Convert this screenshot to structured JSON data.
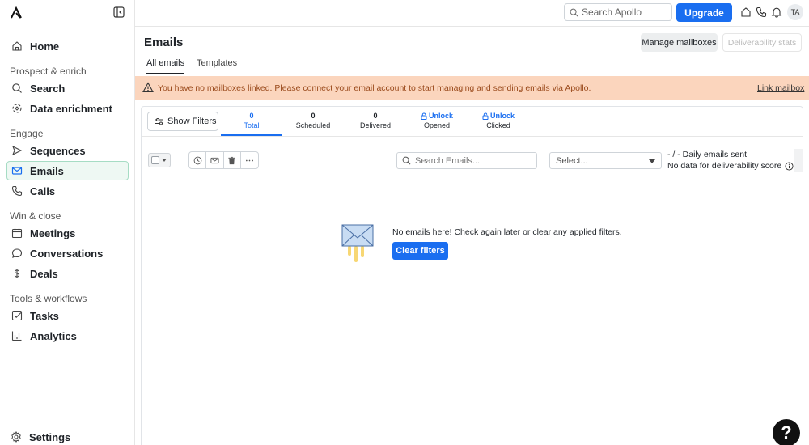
{
  "sidebar": {
    "items": {
      "home": "Home",
      "search": "Search",
      "data_enrichment": "Data enrichment",
      "sequences": "Sequences",
      "emails": "Emails",
      "calls": "Calls",
      "meetings": "Meetings",
      "conversations": "Conversations",
      "deals": "Deals",
      "tasks": "Tasks",
      "analytics": "Analytics",
      "settings": "Settings"
    },
    "sections": {
      "prospect": "Prospect & enrich",
      "engage": "Engage",
      "win": "Win & close",
      "tools": "Tools & workflows"
    }
  },
  "topbar": {
    "search_placeholder": "Search Apollo",
    "upgrade_label": "Upgrade",
    "avatar_initials": "TA"
  },
  "page": {
    "title": "Emails",
    "manage_label": "Manage mailboxes",
    "deliverability_label": "Deliverability stats",
    "tabs": [
      "All emails",
      "Templates"
    ]
  },
  "banner": {
    "text": "You have no mailboxes linked. Please connect your email account to start managing and sending emails via Apollo.",
    "link": "Link mailbox"
  },
  "toolbar": {
    "show_filters": "Show Filters",
    "stats": [
      {
        "value": "0",
        "label": "Total"
      },
      {
        "value": "0",
        "label": "Scheduled"
      },
      {
        "value": "0",
        "label": "Delivered"
      },
      {
        "value": "Unlock",
        "label": "Opened"
      },
      {
        "value": "Unlock",
        "label": "Clicked"
      }
    ],
    "search_placeholder": "Search Emails...",
    "select_placeholder": "Select...",
    "daily_sent": "- / - Daily emails sent",
    "deliverability_score": "No data for deliverability score"
  },
  "empty_state": {
    "message": "No emails here! Check again later or clear any applied filters.",
    "clear_label": "Clear filters"
  },
  "help": {
    "label": "?"
  },
  "colors": {
    "accent": "#1a6ef0",
    "banner_bg": "#fbd5bd",
    "banner_text": "#9a4a1c",
    "active_nav_bg": "#eef8f3",
    "active_nav_border": "#a6dcc4"
  }
}
